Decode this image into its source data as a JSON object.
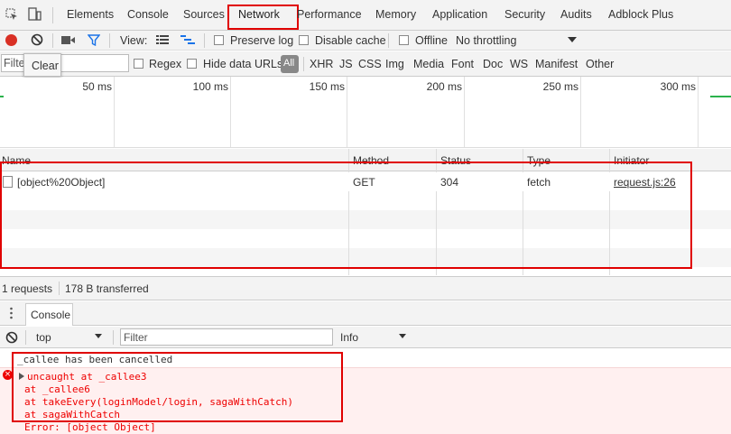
{
  "tabs": [
    "Elements",
    "Console",
    "Sources",
    "Network",
    "Performance",
    "Memory",
    "Application",
    "Security",
    "Audits",
    "Adblock Plus"
  ],
  "toolbar": {
    "view_label": "View:",
    "preserve_log": "Preserve log",
    "disable_cache": "Disable cache",
    "offline": "Offline",
    "throttling": "No throttling"
  },
  "filterbar": {
    "filter_placeholder": "Filter",
    "tooltip": "Clear",
    "regex": "Regex",
    "hide_data_urls": "Hide data URLs",
    "types": [
      "All",
      "XHR",
      "JS",
      "CSS",
      "Img",
      "Media",
      "Font",
      "Doc",
      "WS",
      "Manifest",
      "Other"
    ]
  },
  "timeline": {
    "ticks": [
      "50 ms",
      "100 ms",
      "150 ms",
      "200 ms",
      "250 ms",
      "300 ms"
    ]
  },
  "table": {
    "headers": [
      "Name",
      "Method",
      "Status",
      "Type",
      "Initiator"
    ],
    "rows": [
      {
        "name": "[object%20Object]",
        "method": "GET",
        "status": "304",
        "type": "fetch",
        "initiator": "request.js:26"
      }
    ]
  },
  "summary": {
    "requests": "1 requests",
    "transferred": "178 B transferred"
  },
  "drawer": {
    "tab": "Console",
    "context": "top",
    "filter_placeholder": "Filter",
    "level": "Info"
  },
  "console": {
    "info_line": "_callee has been cancelled",
    "error_lines": [
      "uncaught at _callee3",
      "at _callee6",
      "at takeEvery(loginModel/login, sagaWithCatch)",
      "at sagaWithCatch",
      "Error: [object Object]"
    ]
  },
  "colors": {
    "accent": "#1a73e8",
    "highlight": "#e00000",
    "record": "#d93025"
  }
}
